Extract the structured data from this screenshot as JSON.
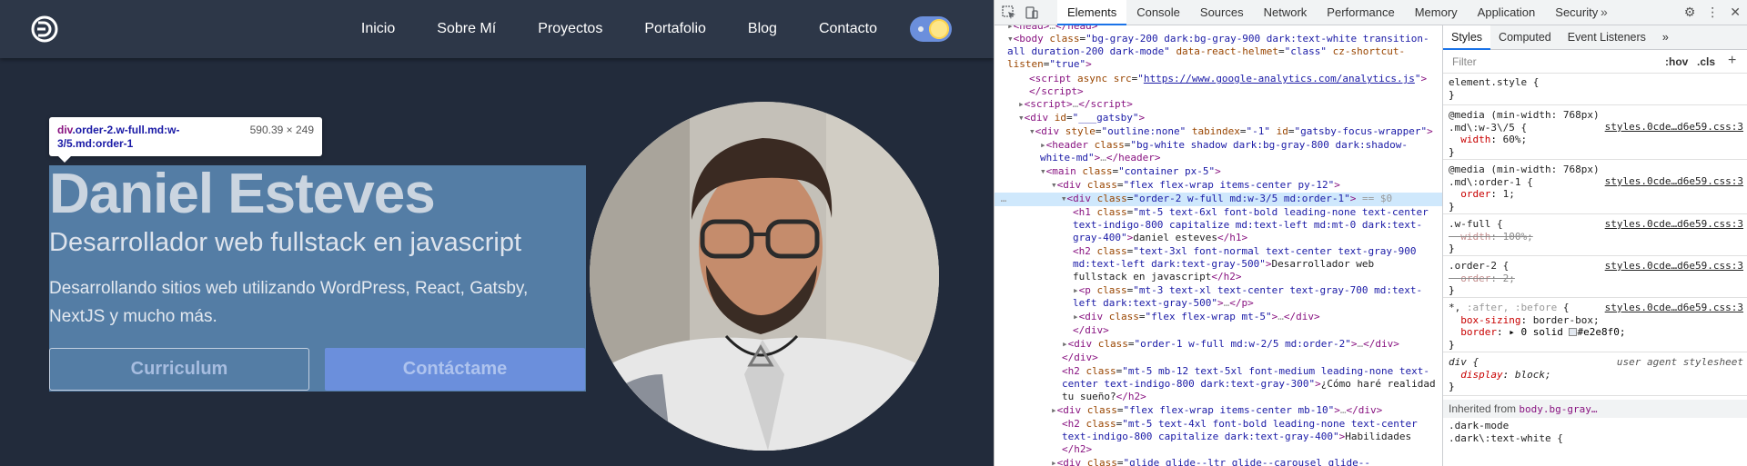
{
  "site": {
    "nav": [
      "Inicio",
      "Sobre Mí",
      "Proyectos",
      "Portafolio",
      "Blog",
      "Contacto"
    ],
    "hero": {
      "name": "Daniel Esteves",
      "subtitle": "Desarrollador web fullstack en javascript",
      "description": "Desarrollando sitios web utilizando WordPress, React, Gatsby, NextJS y mucho más.",
      "btn_resume": "Curriculum",
      "btn_contact": "Contáctame"
    },
    "tooltip": {
      "tag": "div",
      "classes": ".order-2.w-full.md:w-3/5.md:order-1",
      "size": "590.39 × 249"
    }
  },
  "devtools": {
    "tabs": [
      "Elements",
      "Console",
      "Sources",
      "Network",
      "Performance",
      "Memory",
      "Application",
      "Security"
    ],
    "active_tab": "Elements",
    "styles_tabs": [
      "Styles",
      "Computed",
      "Event Listeners"
    ],
    "filter_placeholder": "Filter",
    "hov": ":hov",
    "cls": ".cls",
    "inherited_from": "Inherited from",
    "inherited_selector": "body.bg-gray…"
  },
  "colors": {
    "site_bg": "#222b3b",
    "header_bg": "#2d3748",
    "accent": "#6b8fdc",
    "highlight": "#6fa8dc",
    "devtools_tab_underline": "#1a73e8"
  }
}
